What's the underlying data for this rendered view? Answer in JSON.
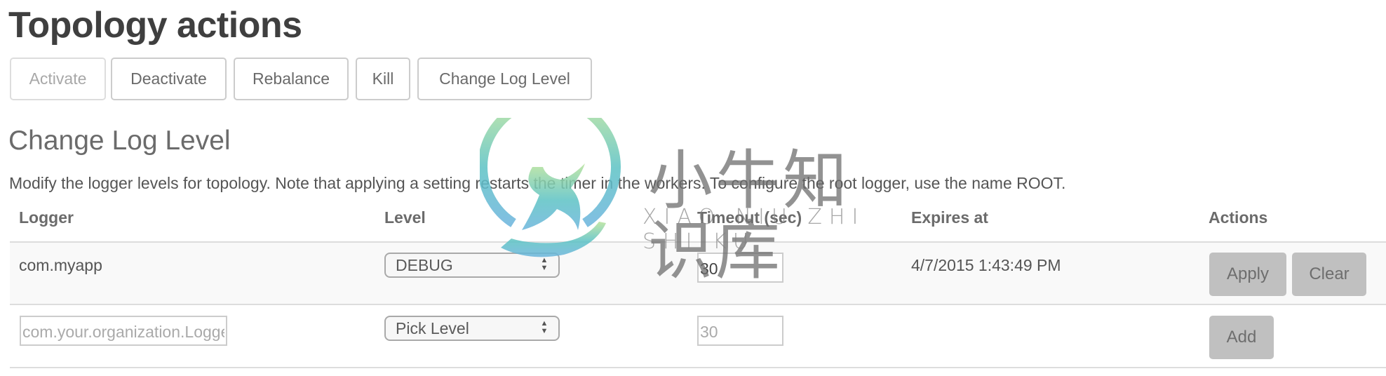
{
  "page": {
    "title": "Topology actions"
  },
  "actions": {
    "buttons": [
      {
        "label": "Activate",
        "disabled": true
      },
      {
        "label": "Deactivate",
        "disabled": false
      },
      {
        "label": "Rebalance",
        "disabled": false
      },
      {
        "label": "Kill",
        "disabled": false
      },
      {
        "label": "Change Log Level",
        "disabled": false
      }
    ]
  },
  "log_level": {
    "title": "Change Log Level",
    "description": "Modify the logger levels for topology. Note that applying a setting restarts the timer in the workers. To configure the root logger, use the name ROOT.",
    "columns": [
      "Logger",
      "Level",
      "Timeout (sec)",
      "Expires at",
      "Actions"
    ],
    "rows": [
      {
        "logger": "com.myapp",
        "level": "DEBUG",
        "timeout": "30",
        "expires_at": "4/7/2015 1:43:49 PM",
        "apply_label": "Apply",
        "clear_label": "Clear"
      }
    ],
    "new_row": {
      "logger_placeholder": "com.your.organization.LoggerName",
      "level": "Pick Level",
      "timeout_placeholder": "30",
      "add_label": "Add"
    }
  },
  "watermark": {
    "chinese": "小牛知识库",
    "latin": "XIAO NIU ZHI SHI KU",
    "colors": {
      "green": "#a9dc8f",
      "teal": "#5bbfc8",
      "blue": "#6cb6dc"
    }
  }
}
